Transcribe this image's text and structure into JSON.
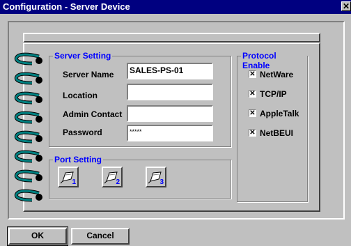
{
  "window": {
    "title": "Configuration - Server Device",
    "close_glyph": "✕"
  },
  "server_setting": {
    "title": "Server Setting",
    "fields": [
      {
        "label": "Server Name",
        "value": "SALES-PS-01"
      },
      {
        "label": "Location",
        "value": ""
      },
      {
        "label": "Admin Contact",
        "value": ""
      },
      {
        "label": "Password",
        "value": "*****"
      }
    ]
  },
  "protocol_enable": {
    "title": "Protocol Enable",
    "items": [
      {
        "label": "NetWare",
        "checked": true
      },
      {
        "label": "TCP/IP",
        "checked": true
      },
      {
        "label": "AppleTalk",
        "checked": true
      },
      {
        "label": "NetBEUI",
        "checked": true
      }
    ],
    "check_glyph": "✕"
  },
  "port_setting": {
    "title": "Port Setting",
    "ports": [
      {
        "number": "1"
      },
      {
        "number": "2"
      },
      {
        "number": "3"
      }
    ]
  },
  "buttons": {
    "ok": "OK",
    "cancel": "Cancel"
  },
  "colors": {
    "title_bar": "#000080",
    "group_title": "#0000ff",
    "ring": "#008080",
    "face": "#c0c0c0"
  }
}
